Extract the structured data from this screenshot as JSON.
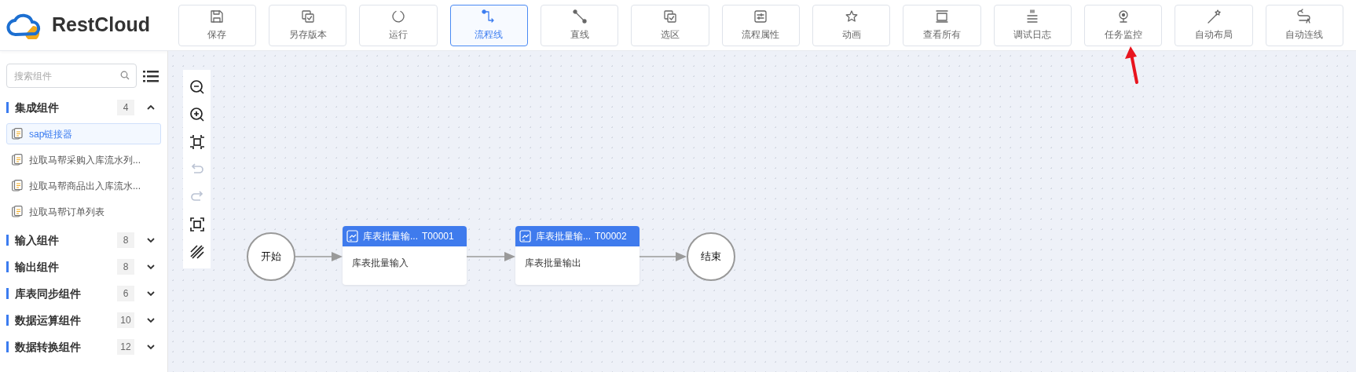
{
  "logo": {
    "text": "RestCloud"
  },
  "toolbar": [
    {
      "label": "保存",
      "selected": false
    },
    {
      "label": "另存版本",
      "selected": false
    },
    {
      "label": "运行",
      "selected": false
    },
    {
      "label": "流程线",
      "selected": true
    },
    {
      "label": "直线",
      "selected": false
    },
    {
      "label": "选区",
      "selected": false
    },
    {
      "label": "流程属性",
      "selected": false
    },
    {
      "label": "动画",
      "selected": false
    },
    {
      "label": "查看所有",
      "selected": false
    },
    {
      "label": "调试日志",
      "selected": false
    },
    {
      "label": "任务监控",
      "selected": false
    },
    {
      "label": "自动布局",
      "selected": false
    },
    {
      "label": "自动连线",
      "selected": false
    }
  ],
  "sidebar": {
    "search": {
      "placeholder": "搜索组件"
    },
    "groups": [
      {
        "title": "集成组件",
        "count": "4",
        "expanded": true,
        "items": [
          {
            "label": "sap链接器",
            "selected": true
          },
          {
            "label": "拉取马帮采购入库流水列...",
            "selected": false
          },
          {
            "label": "拉取马帮商品出入库流水...",
            "selected": false
          },
          {
            "label": "拉取马帮订单列表",
            "selected": false
          }
        ]
      },
      {
        "title": "输入组件",
        "count": "8",
        "expanded": false
      },
      {
        "title": "输出组件",
        "count": "8",
        "expanded": false
      },
      {
        "title": "库表同步组件",
        "count": "6",
        "expanded": false
      },
      {
        "title": "数据运算组件",
        "count": "10",
        "expanded": false
      },
      {
        "title": "数据转换组件",
        "count": "12",
        "expanded": false
      }
    ]
  },
  "canvas_tools": [
    {
      "disabled": false
    },
    {
      "disabled": false
    },
    {
      "disabled": false
    },
    {
      "disabled": true
    },
    {
      "disabled": true
    },
    {
      "disabled": false
    },
    {
      "disabled": false
    }
  ],
  "flow": {
    "nodes": [
      {
        "kind": "start",
        "label": "开始"
      },
      {
        "kind": "task",
        "title": "库表批量输...",
        "code": "T00001",
        "body": "库表批量输入"
      },
      {
        "kind": "task",
        "title": "库表批量输...",
        "code": "T00002",
        "body": "库表批量输出"
      },
      {
        "kind": "end",
        "label": "结束"
      }
    ]
  }
}
